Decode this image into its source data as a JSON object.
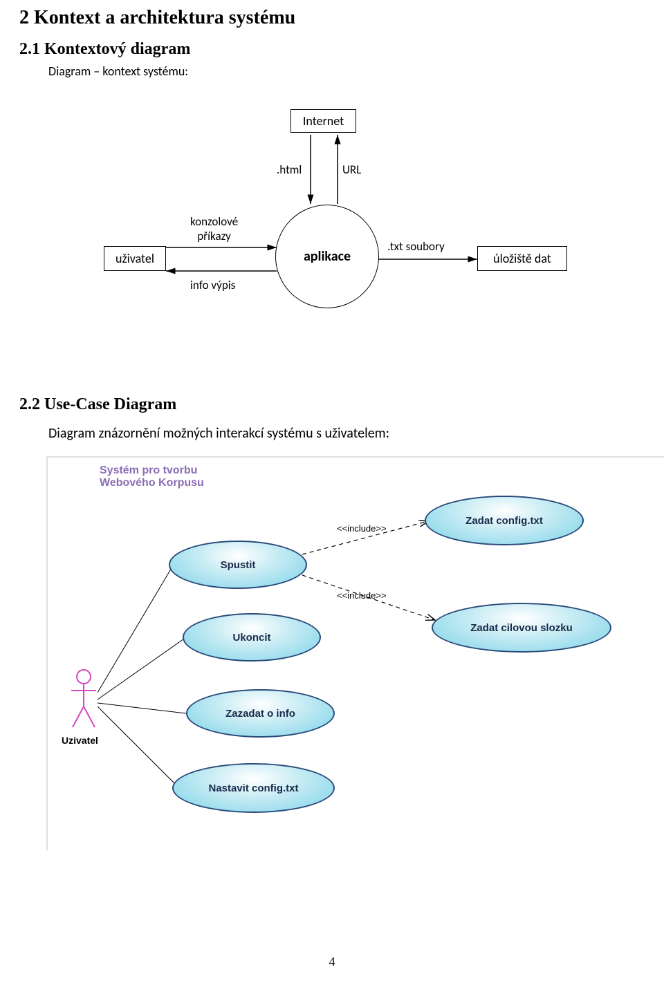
{
  "headings": {
    "h1": "2  Kontext a architektura systému",
    "h2_1": "2.1  Kontextový diagram",
    "ctx_caption": "Diagram – kontext systému:",
    "h2_2": "2.2  Use-Case Diagram",
    "uc_caption": "Diagram znázornění možných interakcí systému s uživatelem:"
  },
  "page_number": "4",
  "context_diagram": {
    "nodes": {
      "internet": "Internet",
      "uzivatel": "uživatel",
      "aplikace": "aplikace",
      "uloziste": "úložiště dat"
    },
    "edges": {
      "html": ".html",
      "url": "URL",
      "konzolove": "konzolové\npříkazy",
      "info": "info výpis",
      "txt": ".txt soubory"
    }
  },
  "usecase_diagram": {
    "system_title": "Systém pro tvorbu\nWebového Korpusu",
    "actor": "Uzivatel",
    "usecases": {
      "spustit": "Spustit",
      "ukoncit": "Ukoncit",
      "zazadat": "Zazadat o info",
      "nastavit": "Nastavit config.txt",
      "zadat_config": "Zadat config.txt",
      "zadat_slozku": "Zadat cilovou slozku"
    },
    "include_label": "<<include>>"
  }
}
